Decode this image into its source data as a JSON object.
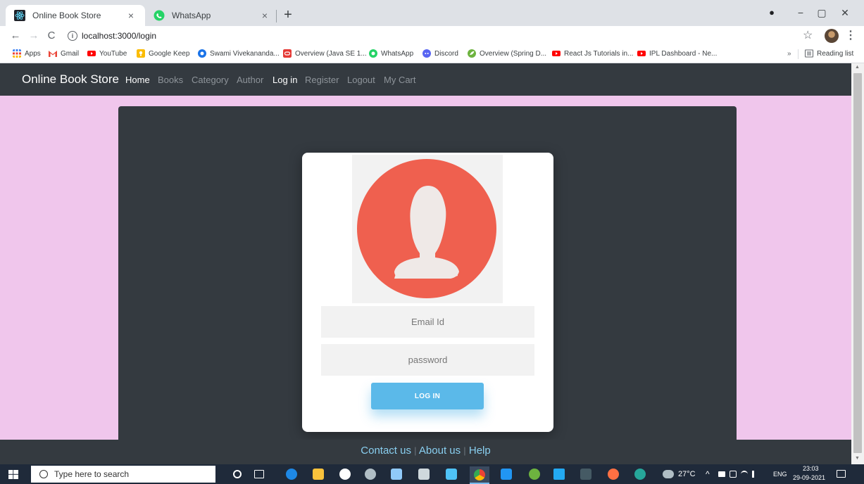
{
  "browser": {
    "tabs": [
      {
        "title": "Online Book Store",
        "close": "×",
        "active": true
      },
      {
        "title": "WhatsApp",
        "close": "×",
        "active": false
      }
    ],
    "new_tab": "+",
    "window": {
      "minimize": "−",
      "maximize": "▢",
      "close": "✕",
      "record": "●"
    },
    "nav": {
      "back": "←",
      "forward": "→",
      "reload": "C"
    },
    "url": "localhost:3000/login",
    "info_icon": "i",
    "star": "☆",
    "menu": "⋮"
  },
  "bookmarks": {
    "items": [
      {
        "label": "Apps",
        "color": "#4285f4"
      },
      {
        "label": "Gmail",
        "color": "#ea4335"
      },
      {
        "label": "YouTube",
        "color": "#ff0000"
      },
      {
        "label": "Google Keep",
        "color": "#fbbc04"
      },
      {
        "label": "Swami Vivekananda...",
        "color": "#1a73e8"
      },
      {
        "label": "Overview (Java SE 1...",
        "color": "#e53935"
      },
      {
        "label": "WhatsApp",
        "color": "#25d366"
      },
      {
        "label": "Discord",
        "color": "#5865f2"
      },
      {
        "label": "Overview (Spring D...",
        "color": "#6db33f"
      },
      {
        "label": "React Js Tutorials in...",
        "color": "#ff0000"
      },
      {
        "label": "IPL Dashboard - Ne...",
        "color": "#ff0000"
      }
    ],
    "more": "»",
    "reading_list": "Reading list"
  },
  "site": {
    "brand": "Online Book Store",
    "nav": [
      "Home",
      "Books",
      "Category",
      "Author",
      "Log in",
      "Register",
      "Logout",
      "My Cart"
    ],
    "login": {
      "email_placeholder": "Email Id",
      "password_placeholder": "password",
      "button": "LOG IN"
    },
    "footer": {
      "contact": "Contact us",
      "about": "About us",
      "help": "Help",
      "sep": "|"
    }
  },
  "taskbar": {
    "search_placeholder": "Type here to search",
    "weather": "27°C",
    "lang": "ENG",
    "time": "23:03",
    "date": "29-09-2021",
    "tray": "^"
  },
  "colors": {
    "page_bg": "#f0c6ec",
    "nav_bg": "#343a40",
    "panel_bg": "#343a40",
    "avatar_red": "#ef604f",
    "login_button": "#5bb9e9",
    "footer_link": "#89cff0"
  }
}
